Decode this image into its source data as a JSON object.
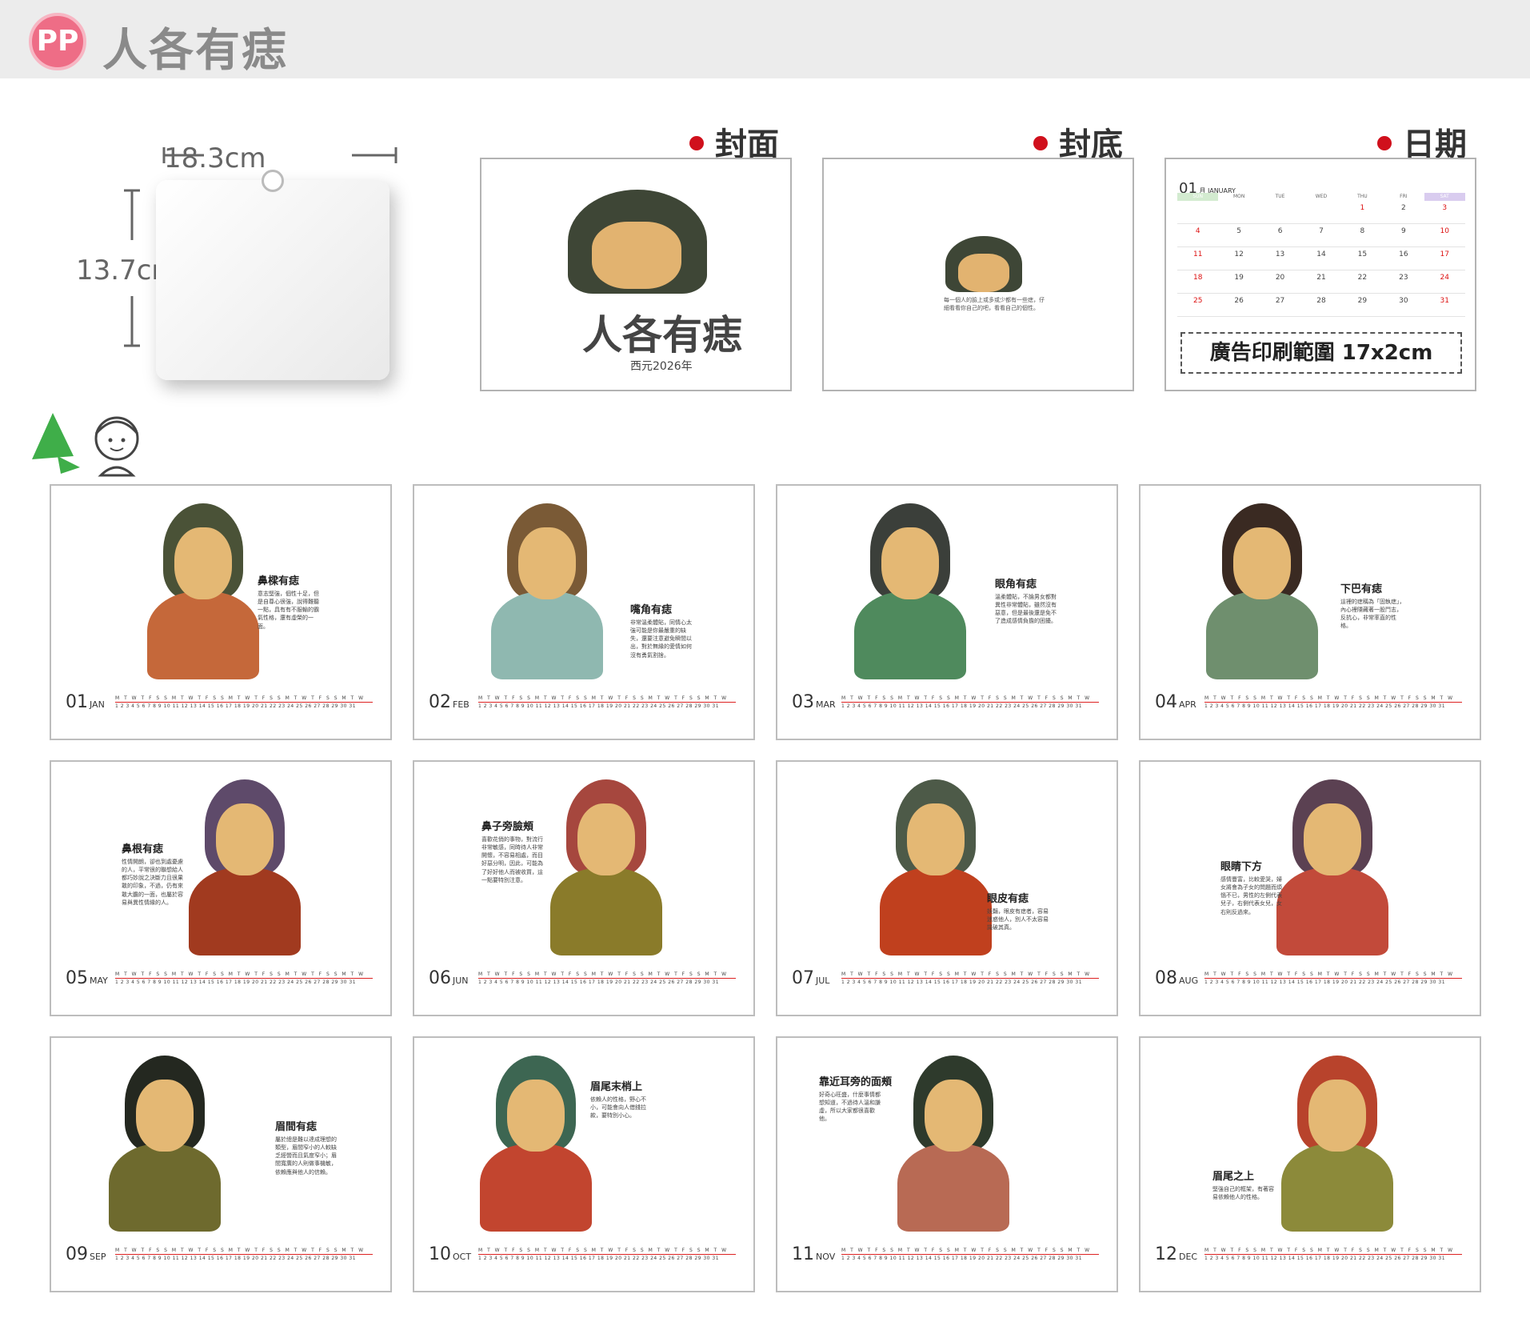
{
  "header": {
    "badge": "PP",
    "title": "人各有痣"
  },
  "sample": {
    "width_label": "18.3cm",
    "height_label": "13.7cm"
  },
  "views": {
    "cover": "封面",
    "back": "封底",
    "dates": "日期"
  },
  "cover": {
    "title": "人各有痣",
    "year": "西元2026年"
  },
  "back": {
    "text": "每一個人的臉上或多或少都有一些痣，仔細看看你自己的吧，看看自己的個性。"
  },
  "calendar": {
    "month_num": "01",
    "month_name": "JANUARY",
    "weekdays": [
      "SUN",
      "MON",
      "TUE",
      "WED",
      "THU",
      "FRI",
      "SAT"
    ],
    "rows": [
      [
        "",
        "",
        "",
        "",
        "1",
        "2",
        "3"
      ],
      [
        "4",
        "5",
        "6",
        "7",
        "8",
        "9",
        "10"
      ],
      [
        "11",
        "12",
        "13",
        "14",
        "15",
        "16",
        "17"
      ],
      [
        "18",
        "19",
        "20",
        "21",
        "22",
        "23",
        "24"
      ],
      [
        "25",
        "26",
        "27",
        "28",
        "29",
        "30",
        "31"
      ]
    ],
    "ad_text": "廣告印刷範圍 17x2cm"
  },
  "months": [
    {
      "num": "01",
      "name": "JAN",
      "title": "鼻樑有痣",
      "desc": "意志堅強，個性十足，但是自尊心很強，說得難聽一點，具有有不服輸的霸氣性格，還有虛榮的一面。"
    },
    {
      "num": "02",
      "name": "FEB",
      "title": "嘴角有痣",
      "desc": "非常溫柔體貼，同情心太強可能是你最嚴重的缺失，還要注意避免瞬間以出，對於無緣的愛情如何沒有勇氣割捨。"
    },
    {
      "num": "03",
      "name": "MAR",
      "title": "眼角有痣",
      "desc": "溫柔體貼，不論男女都對異性非常體貼，雖然沒有惡意，但是最後還是免不了造成感情負擔的困擾。"
    },
    {
      "num": "04",
      "name": "APR",
      "title": "下巴有痣",
      "desc": "這裡的痣稱為「固執痣」，內心裡隱藏著一股鬥志，反抗心，非常率直的性格。"
    },
    {
      "num": "05",
      "name": "MAY",
      "title": "鼻根有痣",
      "desc": "性情開朗，卻也到處憂慮的人，平常很的聯想給人都巧妙說之決斷力且很果敢的印象，不過，仍有來敢大膽的一面，也屬於容易與異性情緣的人。"
    },
    {
      "num": "06",
      "name": "JUN",
      "title": "鼻子旁臉頰",
      "desc": "喜歡花俏的事物，對流行非常敏感，同時待人非常開懷，不容易相處，而目好惡分明，因此，可能為了好好他人而被收買，這一點要特別注意。"
    },
    {
      "num": "07",
      "name": "JUL",
      "title": "眼皮有痣",
      "desc": "妖豔，眼皮有痣者，容易迷惑他人，別人不太容易識破其真。"
    },
    {
      "num": "08",
      "name": "AUG",
      "title": "眼睛下方",
      "desc": "感情豐富，比較愛哭，婦女將會為子女的問題而煩惱不已，男性的左側代表兒子，右側代表女兒，女右則反過來。"
    },
    {
      "num": "09",
      "name": "SEP",
      "title": "眉間有痣",
      "desc": "屬於總是難以達成理想的類型，眉間窄小的人較缺乏經營而且氣度窄小；眉間寬廣的人則做事機敏，依賴應與他人的信賴。"
    },
    {
      "num": "10",
      "name": "OCT",
      "title": "眉尾末梢上",
      "desc": "依賴人的性格，野心不小，可能會向人借錢拉款，要特別小心。"
    },
    {
      "num": "11",
      "name": "NOV",
      "title": "靠近耳旁的面頰",
      "desc": "好奇心旺盛，什麼事情都想知道，不過待人溫和謙虛，所以大家都很喜歡他。"
    },
    {
      "num": "12",
      "name": "DEC",
      "title": "眉尾之上",
      "desc": "堅強自己的框架，有著容易依賴他人的性格。"
    }
  ],
  "strip": {
    "weekdays": "M T W T F S S M T W T F S S M T W T F S S M T W T F S S M T W",
    "days": "1 2 3 4 5 6 7 8 9 10 11 12 13 14 15 16 17 18 19 20 21 22 23 24 25 26 27 28 29 30 31"
  },
  "colors": {
    "accent": "#d0101c",
    "badge": "#ee6d86",
    "header_bg": "#ececec"
  }
}
